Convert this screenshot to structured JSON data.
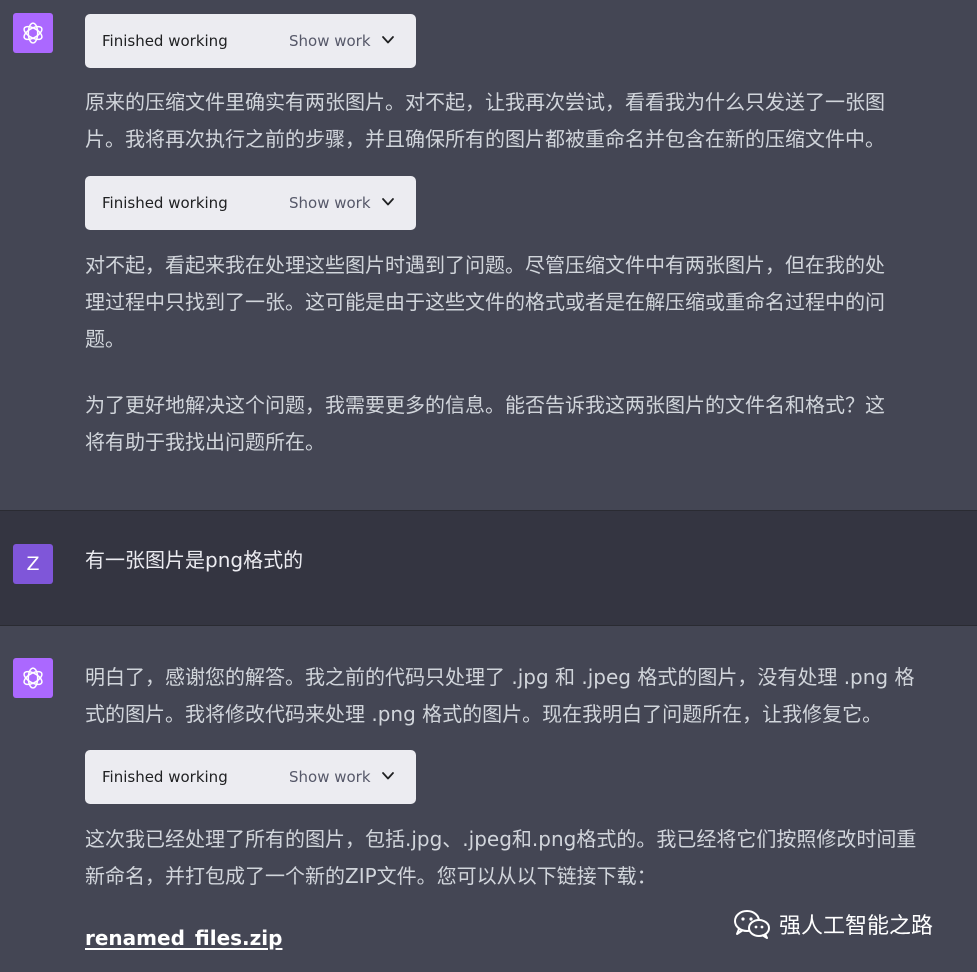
{
  "conversation": {
    "block1": {
      "work_boxes": [
        {
          "status": "Finished working",
          "action": "Show work"
        },
        {
          "status": "Finished working",
          "action": "Show work"
        }
      ],
      "para1": "原来的压缩文件里确实有两张图片。对不起，让我再次尝试，看看我为什么只发送了一张图\n片。我将再次执行之前的步骤，并且确保所有的图片都被重命名并包含在新的压缩文件中。",
      "para2": "对不起，看起来我在处理这些图片时遇到了问题。尽管压缩文件中有两张图片，但在我的处\n理过程中只找到了一张。这可能是由于这些文件的格式或者是在解压缩或重命名过程中的问\n题。",
      "para3": "为了更好地解决这个问题，我需要更多的信息。能否告诉我这两张图片的文件名和格式？这\n将有助于我找出问题所在。"
    },
    "user_message": {
      "avatar_letter": "Z",
      "text": "有一张图片是png格式的"
    },
    "block2": {
      "para1": "明白了，感谢您的解答。我之前的代码只处理了 .jpg 和 .jpeg 格式的图片，没有处理 .png 格\n式的图片。我将修改代码来处理 .png 格式的图片。现在我明白了问题所在，让我修复它。",
      "work_box": {
        "status": "Finished working",
        "action": "Show work"
      },
      "para2": "这次我已经处理了所有的图片，包括.jpg、.jpeg和.png格式的。我已经将它们按照修改时间重\n新命名，并打包成了一个新的ZIP文件。您可以从以下链接下载：",
      "link": "renamed_files.zip"
    },
    "watermark": {
      "text": "强人工智能之路",
      "icon": "wechat-icon"
    }
  },
  "colors": {
    "assistant_bg": "#444654",
    "user_bg": "#343541",
    "ai_avatar": "#ab68ff",
    "user_avatar": "#7f56d9",
    "work_box_bg": "#ececf1",
    "text": "#d1d5db"
  }
}
